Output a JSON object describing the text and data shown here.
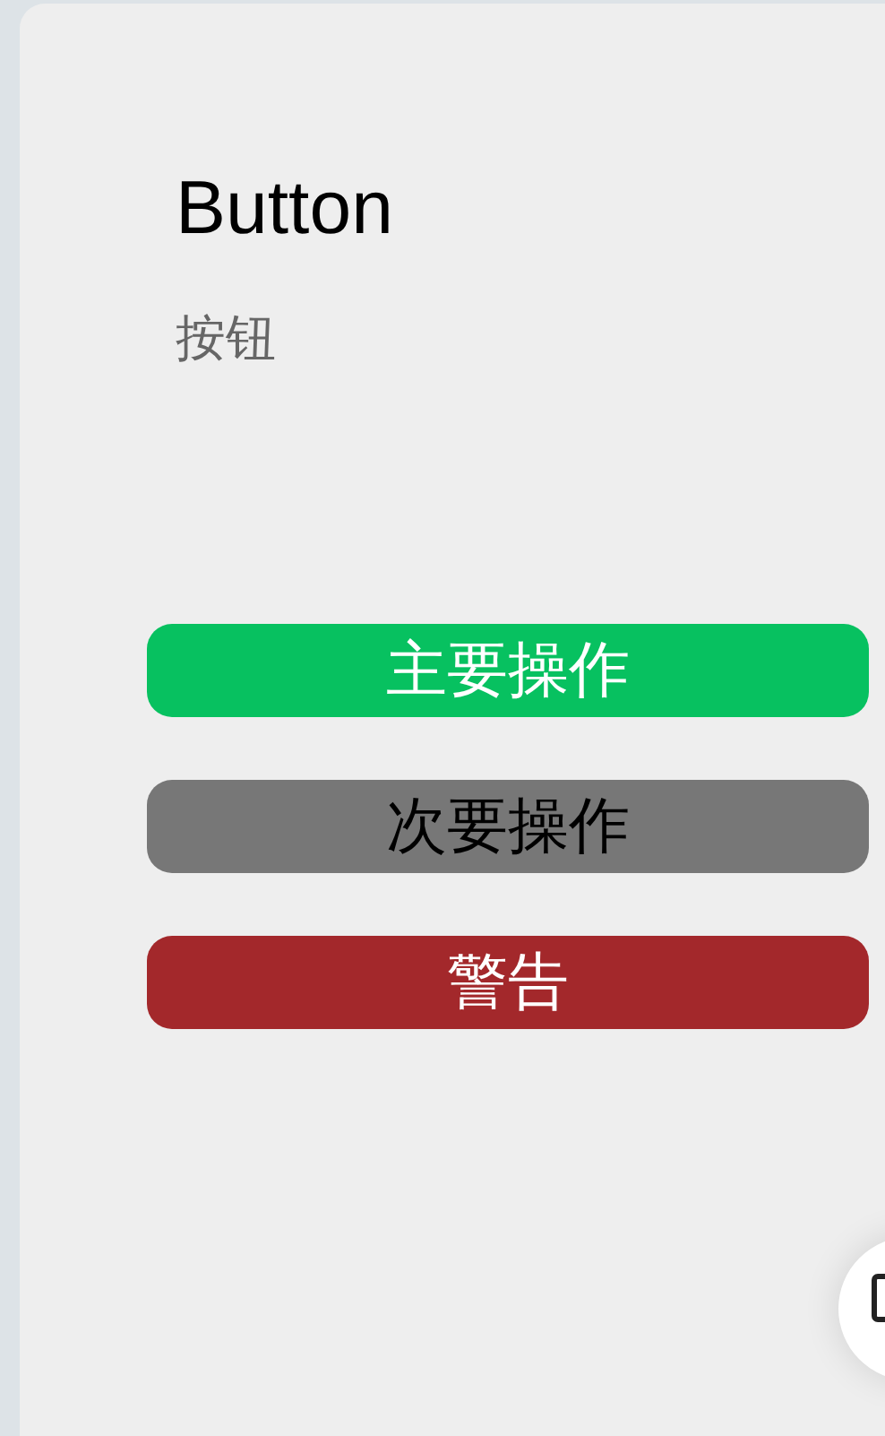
{
  "title": "Button",
  "subtitle": "按钮",
  "buttons": [
    {
      "label": "主要操作",
      "kind": "primary"
    },
    {
      "label": "次要操作",
      "kind": "secondary"
    },
    {
      "label": "警告",
      "kind": "warning"
    }
  ]
}
